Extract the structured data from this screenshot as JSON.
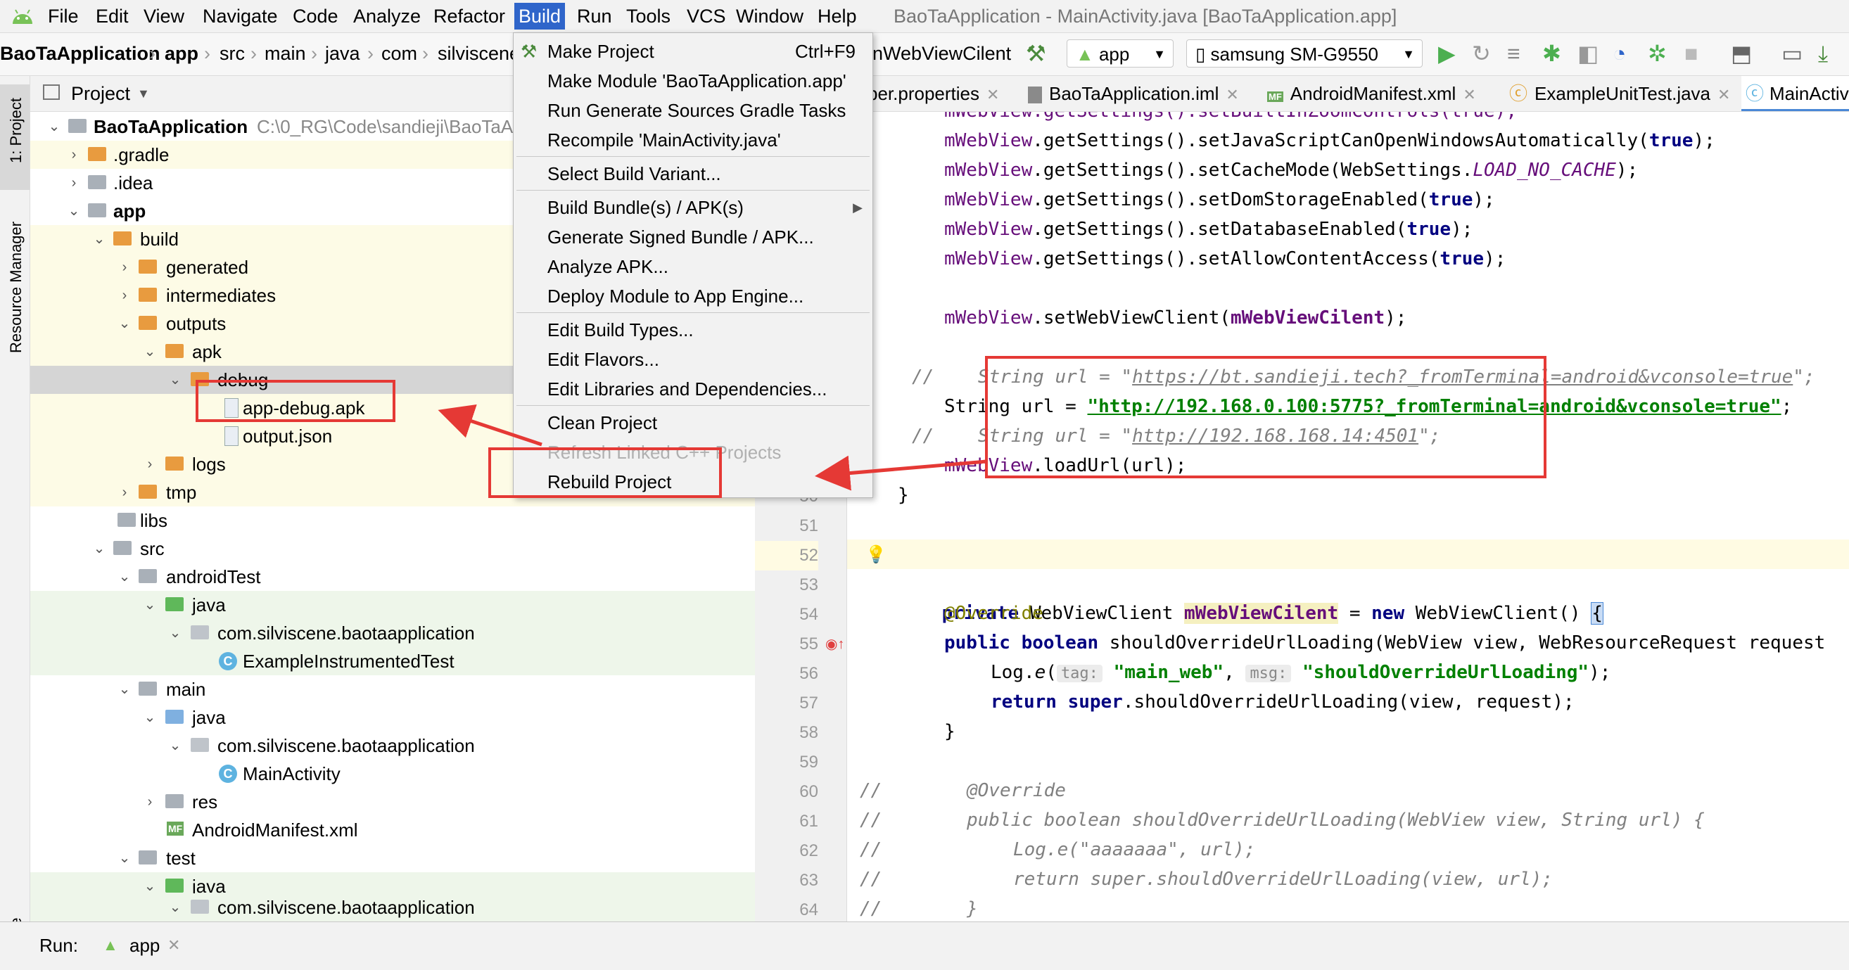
{
  "menubar": {
    "items": [
      "File",
      "Edit",
      "View",
      "Navigate",
      "Code",
      "Analyze",
      "Refactor",
      "Build",
      "Run",
      "Tools",
      "VCS",
      "Window",
      "Help"
    ],
    "window_title": "BaoTaApplication - MainActivity.java [BaoTaApplication.app]"
  },
  "navbar": {
    "breadcrumbs": [
      "BaoTaApplication",
      "app",
      "src",
      "main",
      "java",
      "com",
      "silviscene"
    ],
    "tail_text": "nWebViewCilent",
    "run_config": "app",
    "device": "samsung SM-G9550"
  },
  "left_strip": {
    "project_tab": "1: Project",
    "resource_tab": "Resource Manager",
    "structure_tab": "ructure"
  },
  "project_panel": {
    "header": "Project",
    "tree": [
      {
        "label": "BaoTaApplication",
        "path": "C:\\0_RG\\Code\\sandieji\\BaoTaAp"
      },
      {
        "label": ".gradle"
      },
      {
        "label": ".idea"
      },
      {
        "label": "app"
      },
      {
        "label": "build"
      },
      {
        "label": "generated"
      },
      {
        "label": "intermediates"
      },
      {
        "label": "outputs"
      },
      {
        "label": "apk"
      },
      {
        "label": "debug"
      },
      {
        "label": "app-debug.apk"
      },
      {
        "label": "output.json"
      },
      {
        "label": "logs"
      },
      {
        "label": "tmp"
      },
      {
        "label": "libs"
      },
      {
        "label": "src"
      },
      {
        "label": "androidTest"
      },
      {
        "label": "java"
      },
      {
        "label": "com.silviscene.baotaapplication"
      },
      {
        "label": "ExampleInstrumentedTest"
      },
      {
        "label": "main"
      },
      {
        "label": "java"
      },
      {
        "label": "com.silviscene.baotaapplication"
      },
      {
        "label": "MainActivity"
      },
      {
        "label": "res"
      },
      {
        "label": "AndroidManifest.xml"
      },
      {
        "label": "test"
      },
      {
        "label": "java"
      },
      {
        "label": "com.silviscene.baotaapplication"
      }
    ]
  },
  "editor_tabs": [
    "per.properties",
    "BaoTaApplication.iml",
    "AndroidManifest.xml",
    "ExampleUnitTest.java",
    "MainActivi"
  ],
  "build_menu": {
    "items": [
      {
        "label": "Make Project",
        "shortcut": "Ctrl+F9"
      },
      {
        "label": "Make Module 'BaoTaApplication.app'"
      },
      {
        "label": "Run Generate Sources Gradle Tasks"
      },
      {
        "label": "Recompile 'MainActivity.java'"
      },
      {
        "label": "Select Build Variant..."
      },
      {
        "label": "Build Bundle(s) / APK(s)"
      },
      {
        "label": "Generate Signed Bundle / APK..."
      },
      {
        "label": "Analyze APK..."
      },
      {
        "label": "Deploy Module to App Engine..."
      },
      {
        "label": "Edit Build Types..."
      },
      {
        "label": "Edit Flavors..."
      },
      {
        "label": "Edit Libraries and Dependencies..."
      },
      {
        "label": "Clean Project"
      },
      {
        "label": "Refresh Linked C++ Projects"
      },
      {
        "label": "Rebuild Project"
      }
    ]
  },
  "code": {
    "line_numbers": [
      "50",
      "51",
      "52",
      "53",
      "54",
      "55",
      "56",
      "57",
      "58",
      "59",
      "60",
      "61",
      "62",
      "63",
      "64"
    ],
    "lines": {
      "l0": "mWebView.getSettings().setBuiltInZoomControls(true);",
      "l1a": "mWebView",
      "l1b": ".getSettings().setJavaScriptCanOpenWindowsAutomatically(",
      "l1c": "true",
      "l1d": ");",
      "l2a": "mWebView",
      "l2b": ".getSettings().setCacheMode(WebSettings.",
      "l2c": "LOAD_NO_CACHE",
      "l2d": ");",
      "l3a": "mWebView",
      "l3b": ".getSettings().setDomStorageEnabled(",
      "l3c": "true",
      "l3d": ");",
      "l4a": "mWebView",
      "l4b": ".getSettings().setDatabaseEnabled(",
      "l4c": "true",
      "l4d": ");",
      "l5a": "mWebView",
      "l5b": ".getSettings().setAllowContentAccess(",
      "l5c": "true",
      "l5d": ");",
      "l7a": "mWebView",
      "l7b": ".setWebViewClient(",
      "l7c": "mWebViewCilent",
      "l7d": ");",
      "l9a": "//    String url = \"",
      "l9b": "https://bt.sandieji.tech?_fromTerminal=android&vconsole=true",
      "l9c": "\";",
      "l10a": "String url = ",
      "l10b": "\"http://192.168.0.100:5775?_fromTerminal=android&vconsole=true\"",
      "l10c": ";",
      "l11a": "//    String url = \"",
      "l11b": "http://192.168.168.14:4501",
      "l11c": "\";",
      "l12a": "mWebView",
      "l12b": ".loadUrl(url);",
      "l13": "}",
      "l15a": "private",
      "l15b": " WebViewClient ",
      "l15c": "mWebViewCilent",
      "l15d": " = ",
      "l15e": "new",
      "l15f": " WebViewClient() ",
      "l15g": "{",
      "l17": "@Override",
      "l18a": "public boolean",
      "l18b": " shouldOverrideUrlLoading(WebView view, WebResourceRequest request",
      "l19a": "Log.",
      "l19b": "e",
      "l19c": "(",
      "l19d": "tag:",
      "l19e": "\"main_web\"",
      "l19f": ", ",
      "l19g": "msg:",
      "l19h": "\"shouldOverrideUrlLoading\"",
      "l19i": ");",
      "l20a": "return super",
      "l20b": ".shouldOverrideUrlLoading(view, request);",
      "l21": "}",
      "l23a": "//",
      "l23b": "@Override",
      "l24a": "//",
      "l24b": "public boolean shouldOverrideUrlLoading(WebView view, String url) {",
      "l25a": "//",
      "l25b": "Log.e(\"aaaaaaa\", url);",
      "l26a": "//",
      "l26b": "return super.shouldOverrideUrlLoading(view, url);",
      "l27a": "//",
      "l27b": "}"
    }
  },
  "runbar": {
    "label": "Run:",
    "config": "app"
  },
  "colors": {
    "accent": "#2f65ca",
    "annotation": "#e53935",
    "android_green": "#78c257"
  }
}
